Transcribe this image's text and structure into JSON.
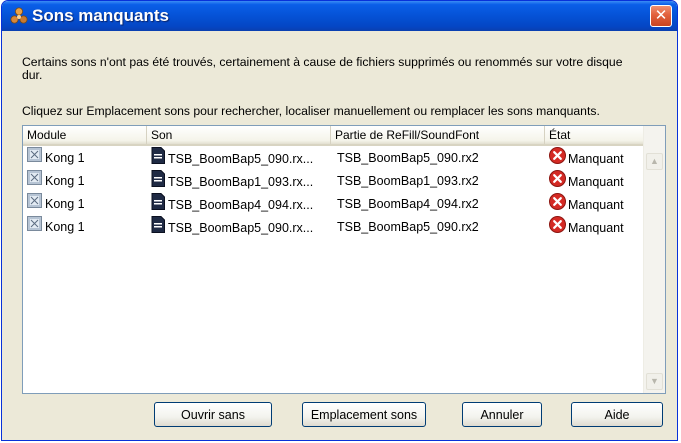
{
  "window": {
    "title": "Sons manquants",
    "close_symbol": "✕"
  },
  "messages": {
    "line1": "Certains sons n'ont pas été trouvés, certainement à cause de fichiers supprimés ou renommés sur votre disque dur.",
    "line2": "Cliquez sur Emplacement sons pour rechercher, localiser manuellement ou remplacer les sons manquants."
  },
  "list": {
    "columns": [
      "Module",
      "Son",
      "Partie de ReFill/SoundFont",
      "État"
    ],
    "rows": [
      {
        "module": "Kong 1",
        "son": "TSB_BoomBap5_090.rx...",
        "partie": "TSB_BoomBap5_090.rx2",
        "etat": "Manquant"
      },
      {
        "module": "Kong 1",
        "son": "TSB_BoomBap1_093.rx...",
        "partie": "TSB_BoomBap1_093.rx2",
        "etat": "Manquant"
      },
      {
        "module": "Kong 1",
        "son": "TSB_BoomBap4_094.rx...",
        "partie": "TSB_BoomBap4_094.rx2",
        "etat": "Manquant"
      },
      {
        "module": "Kong 1",
        "son": "TSB_BoomBap5_090.rx...",
        "partie": "TSB_BoomBap5_090.rx2",
        "etat": "Manquant"
      }
    ]
  },
  "buttons": {
    "open": "Ouvrir sans",
    "locate": "Emplacement sons",
    "cancel": "Annuler",
    "help": "Aide"
  },
  "icons": {
    "title": "reason-app-icon",
    "module": "kong-module-icon",
    "file": "sound-file-icon",
    "missing": "error-x-icon"
  },
  "colors": {
    "titlebar": "#0552d6",
    "dialog_bg": "#ece9d8",
    "close_button": "#e2603c",
    "error": "#d42a24"
  }
}
